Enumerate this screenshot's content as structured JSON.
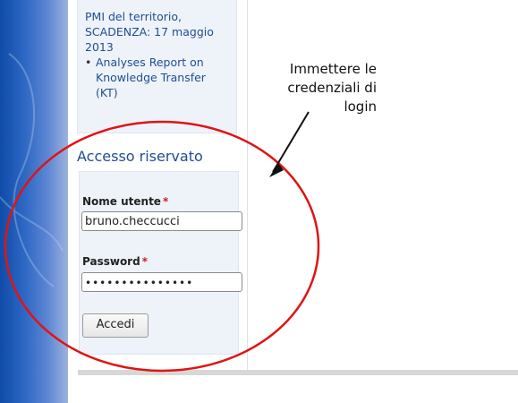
{
  "sidebar": {
    "news_fragment_1": "PMI del territorio,",
    "news_fragment_2": "SCADENZA: 17 maggio",
    "news_fragment_3": "2013",
    "news_item_2": [
      "Analyses Report on",
      "Knowledge Transfer",
      "(KT)"
    ],
    "bullet": "•"
  },
  "login": {
    "title": "Accesso riservato",
    "username_label": "Nome utente",
    "password_label": "Password",
    "required_mark": "*",
    "username_value": "bruno.checcucci",
    "password_mask": "•••••••••••••••",
    "submit_label": "Accedi"
  },
  "annotation": {
    "lines": [
      "Immettere le",
      "credenziali di",
      "login"
    ]
  },
  "colors": {
    "title": "#1f4e93",
    "required": "#cc1d1d",
    "circle": "#e01414",
    "panel_bg": "#eef3fa"
  }
}
